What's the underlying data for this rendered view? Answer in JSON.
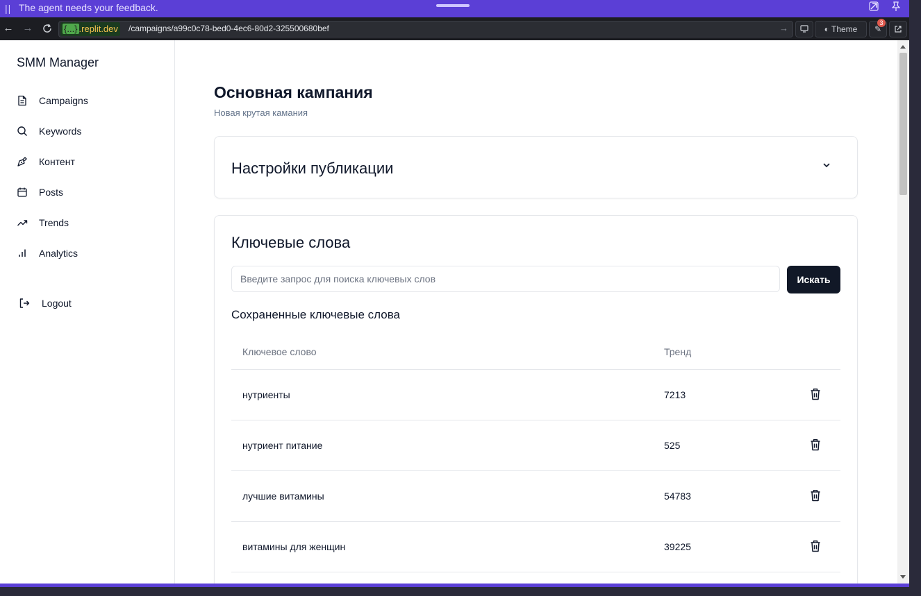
{
  "notice": {
    "message": "The agent needs your feedback.",
    "grip_icon": "drag-handle-icon"
  },
  "browser": {
    "domain_brace": "{...}",
    "domain": ".replit.dev",
    "path": "/campaigns/a99c0c78-bed0-4ec6-80d2-325500680bef",
    "theme_label": "Theme",
    "notification_count": "3"
  },
  "sidebar": {
    "app_title": "SMM Manager",
    "items": [
      {
        "label": "Campaigns",
        "icon": "file-text-icon"
      },
      {
        "label": "Keywords",
        "icon": "search-icon"
      },
      {
        "label": "Контент",
        "icon": "pen-tool-icon"
      },
      {
        "label": "Posts",
        "icon": "calendar-icon"
      },
      {
        "label": "Trends",
        "icon": "trending-up-icon"
      },
      {
        "label": "Analytics",
        "icon": "bar-chart-icon"
      }
    ],
    "logout_label": "Logout"
  },
  "main": {
    "title": "Основная кампания",
    "subtitle": "Новая крутая камания",
    "publication_settings_title": "Настройки публикации",
    "keywords_card": {
      "title": "Ключевые слова",
      "search_placeholder": "Введите запрос для поиска ключевых слов",
      "search_button": "Искать",
      "saved_title": "Сохраненные ключевые слова",
      "columns": {
        "keyword": "Ключевое слово",
        "trend": "Тренд"
      },
      "rows": [
        {
          "keyword": "нутриенты",
          "trend": "7213"
        },
        {
          "keyword": "нутриент питание",
          "trend": "525"
        },
        {
          "keyword": "лучшие витамины",
          "trend": "54783"
        },
        {
          "keyword": "витамины для женщин",
          "trend": "39225"
        }
      ]
    }
  },
  "colors": {
    "frame_accent": "#5b3fd6",
    "primary_button": "#111827"
  }
}
